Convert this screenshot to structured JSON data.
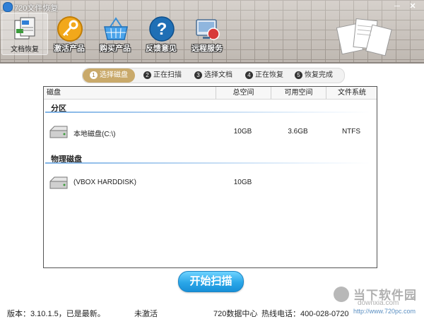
{
  "window": {
    "title": "720文件恢复",
    "minimize": "─",
    "close": "✕"
  },
  "nav": {
    "items": [
      {
        "label": "文档恢复",
        "icon": "documents-icon"
      },
      {
        "label": "激活产品",
        "icon": "key-icon"
      },
      {
        "label": "购买产品",
        "icon": "basket-icon"
      },
      {
        "label": "反馈意见",
        "icon": "help-icon"
      },
      {
        "label": "远程服务",
        "icon": "remote-service-icon"
      }
    ]
  },
  "steps": [
    {
      "num": "1",
      "label": "选择磁盘"
    },
    {
      "num": "2",
      "label": "正在扫描"
    },
    {
      "num": "3",
      "label": "选择文档"
    },
    {
      "num": "4",
      "label": "正在恢复"
    },
    {
      "num": "5",
      "label": "恢复完成"
    }
  ],
  "table": {
    "headers": [
      "磁盘",
      "总空间",
      "可用空间",
      "文件系统"
    ],
    "groups": [
      {
        "title": "分区",
        "rows": [
          {
            "name": "本地磁盘(C:\\)",
            "total": "10GB",
            "free": "3.6GB",
            "fs": "NTFS"
          }
        ]
      },
      {
        "title": "物理磁盘",
        "rows": [
          {
            "name": "(VBOX HARDDISK)",
            "total": "10GB",
            "free": "",
            "fs": ""
          }
        ]
      }
    ]
  },
  "start_button": "开始扫描",
  "status": {
    "version": "版本：3.10.1.5，已是最新。",
    "activation": "未激活",
    "data_center": "720数据中心",
    "hotline": "热线电话：400-028-0720"
  },
  "watermark": {
    "text": "当下软件园",
    "domain": "downxia.com",
    "url": "http://www.720pc.com"
  },
  "colors": {
    "accent": "#2aa6e8",
    "step_active": "#c9a96a",
    "separator": "#7fb3e6"
  }
}
